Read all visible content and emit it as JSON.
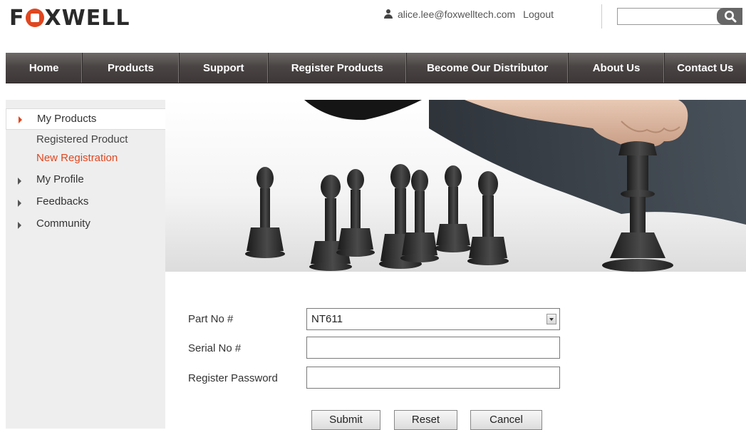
{
  "brand": {
    "logo_text": "FOXWELL",
    "accent": "#e0461f"
  },
  "header": {
    "user_email": "alice.lee@foxwelltech.com",
    "logout_label": "Logout",
    "search_placeholder": ""
  },
  "nav": {
    "items": [
      {
        "label": "Home"
      },
      {
        "label": "Products"
      },
      {
        "label": "Support"
      },
      {
        "label": "Register Products"
      },
      {
        "label": "Become Our Distributor"
      },
      {
        "label": "About Us"
      },
      {
        "label": "Contact Us"
      }
    ]
  },
  "sidebar": {
    "my_products": "My Products",
    "registered_product": "Registered Product",
    "new_registration": "New Registration",
    "my_profile": "My Profile",
    "feedbacks": "Feedbacks",
    "community": "Community"
  },
  "form": {
    "part_no_label": "Part No #",
    "part_no_value": "NT611",
    "serial_no_label": "Serial No #",
    "serial_no_value": "",
    "password_label": "Register Password",
    "password_value": "",
    "submit_label": "Submit",
    "reset_label": "Reset",
    "cancel_label": "Cancel"
  },
  "banner": {
    "icon": "chess-pieces-image"
  }
}
